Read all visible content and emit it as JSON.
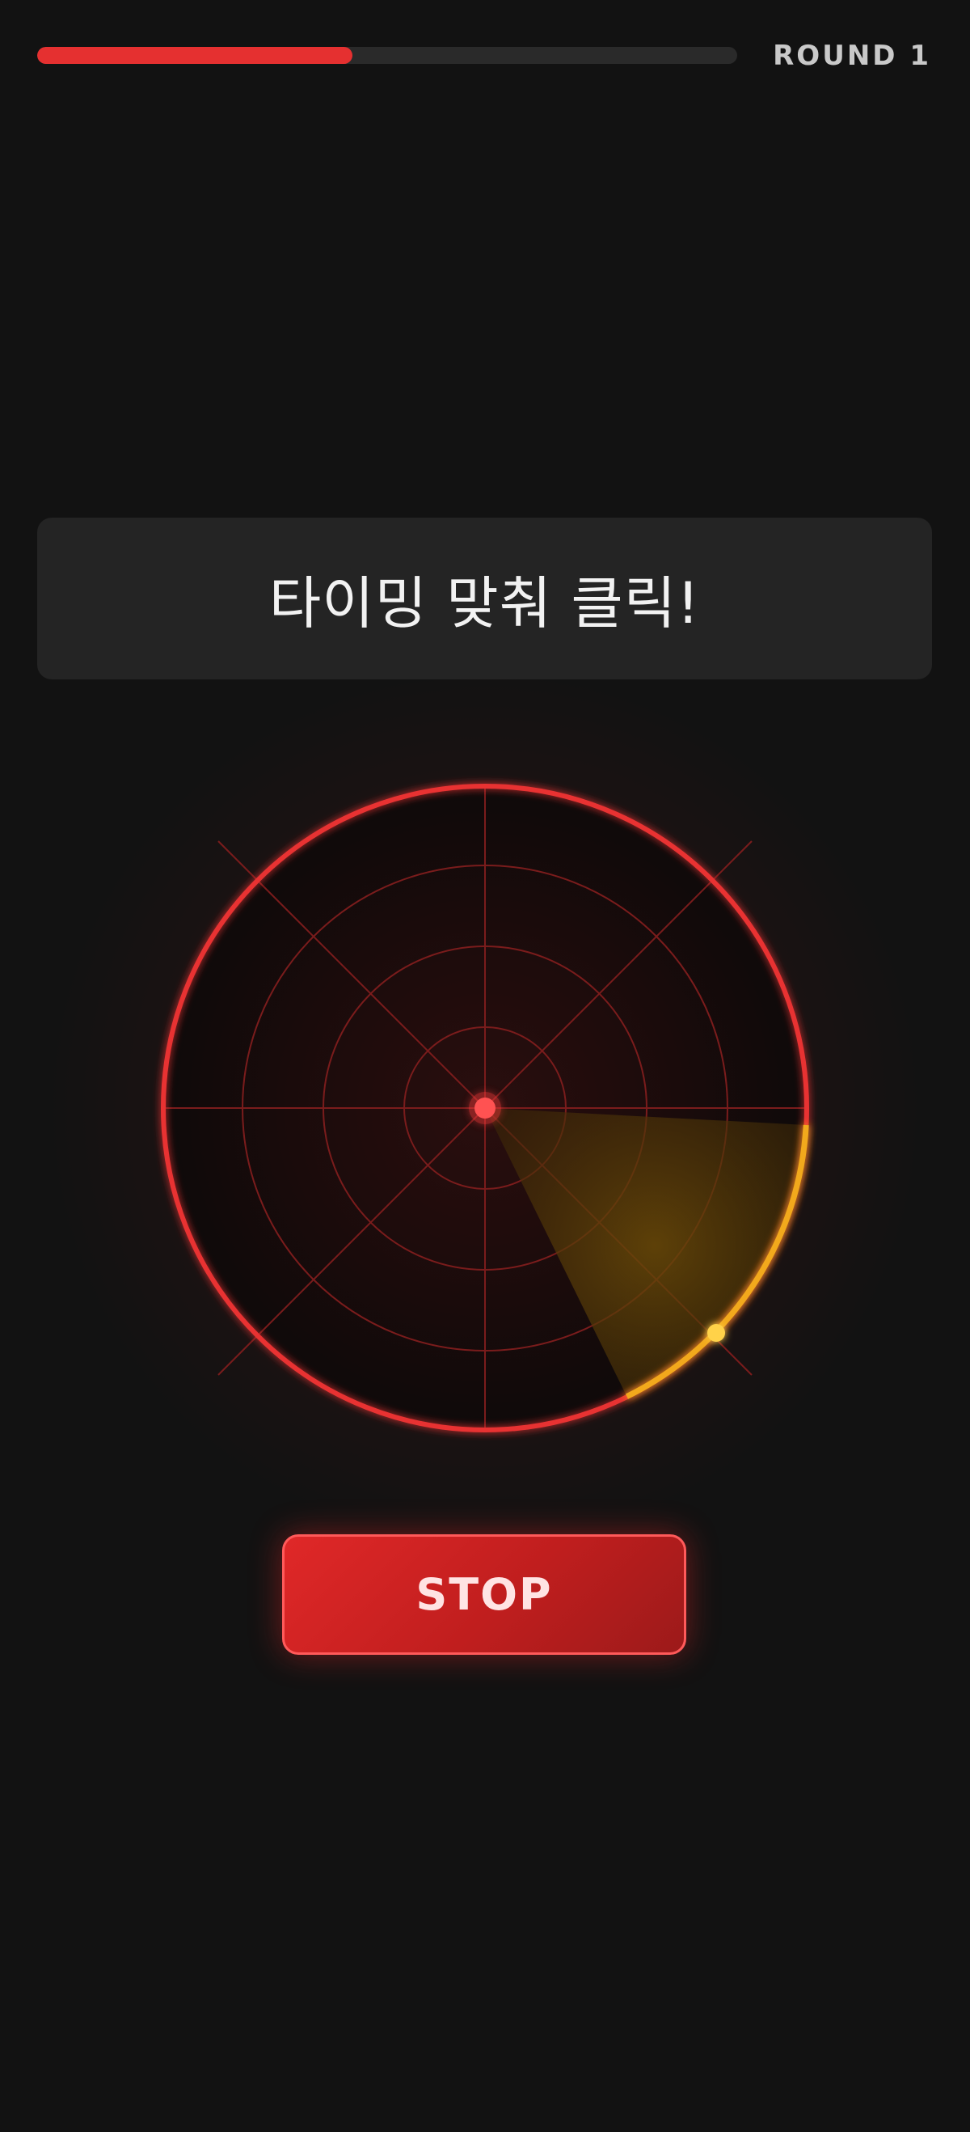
{
  "header": {
    "round_label": "ROUND 1",
    "progress": 0.45
  },
  "instruction": {
    "text": "타이밍 맞춰 클릭!"
  },
  "radar": {
    "sweep_target_icon": "target-zone-arc",
    "marker_icon": "timing-marker-dot",
    "colors": {
      "ring": "#e83232",
      "grid": "#8a1e1e",
      "target_zone": "#f2a91c",
      "center_dot": "#ff4a4a"
    }
  },
  "stop_button": {
    "label": "STOP"
  }
}
